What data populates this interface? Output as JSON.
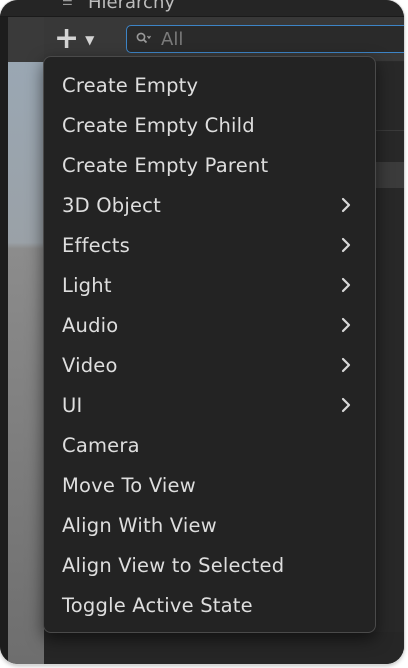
{
  "hierarchy": {
    "title": "Hierarchy",
    "add_button_icon": "plus-icon",
    "dropdown_icon": "caret-down-icon"
  },
  "search": {
    "placeholder": "All",
    "value": "",
    "icon": "search-icon",
    "accent_color": "#3d84c6"
  },
  "menu": {
    "items": [
      {
        "label": "Create Empty",
        "submenu": false
      },
      {
        "label": "Create Empty Child",
        "submenu": false
      },
      {
        "label": "Create Empty Parent",
        "submenu": false
      },
      {
        "label": "3D Object",
        "submenu": true
      },
      {
        "label": "Effects",
        "submenu": true
      },
      {
        "label": "Light",
        "submenu": true
      },
      {
        "label": "Audio",
        "submenu": true
      },
      {
        "label": "Video",
        "submenu": true
      },
      {
        "label": "UI",
        "submenu": true
      },
      {
        "label": "Camera",
        "submenu": false
      },
      {
        "label": "Move To View",
        "submenu": false
      },
      {
        "label": "Align With View",
        "submenu": false
      },
      {
        "label": "Align View to Selected",
        "submenu": false
      },
      {
        "label": "Toggle Active State",
        "submenu": false
      }
    ],
    "submenu_icon": "chevron-right-icon",
    "background_color": "#232323",
    "text_color": "#dedede"
  }
}
